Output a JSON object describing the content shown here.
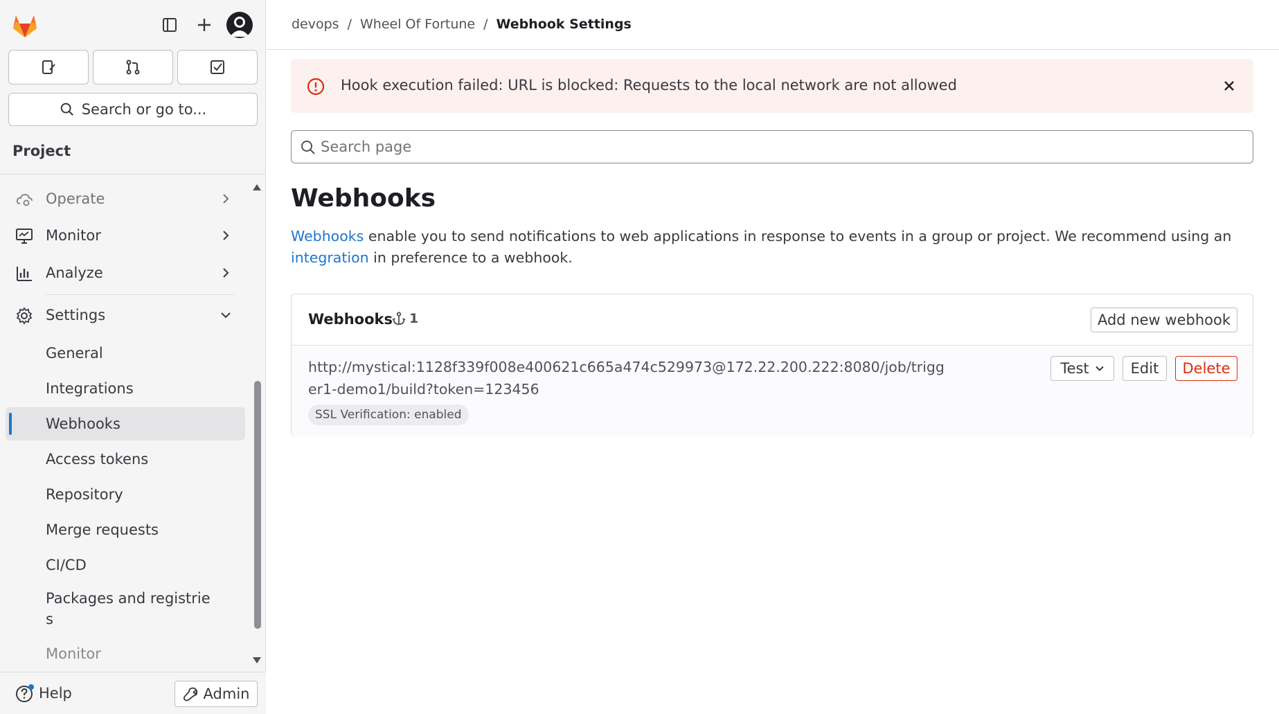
{
  "sidebar": {
    "section_title": "Project",
    "search_label": "Search or go to...",
    "nav": [
      {
        "label": "Operate",
        "icon": "cloud-gear-icon"
      },
      {
        "label": "Monitor",
        "icon": "monitor-icon"
      },
      {
        "label": "Analyze",
        "icon": "chart-icon"
      },
      {
        "label": "Settings",
        "icon": "gear-icon"
      }
    ],
    "settings_items": [
      "General",
      "Integrations",
      "Webhooks",
      "Access tokens",
      "Repository",
      "Merge requests",
      "CI/CD",
      "Packages and registrie s",
      "Monitor"
    ],
    "active_item": "Webhooks",
    "help_label": "Help",
    "admin_label": "Admin"
  },
  "breadcrumb": {
    "items": [
      "devops",
      "Wheel Of Fortune",
      "Webhook Settings"
    ]
  },
  "alert": {
    "message": "Hook execution failed: URL is blocked: Requests to the local network are not allowed"
  },
  "search": {
    "placeholder": "Search page"
  },
  "page": {
    "title": "Webhooks",
    "desc_link1": "Webhooks",
    "desc_text1": " enable you to send notifications to web applications in response to events in a group or project. We recommend using an ",
    "desc_link2": "integration",
    "desc_text2": " in preference to a webhook."
  },
  "card": {
    "title": "Webhooks",
    "count": "1",
    "add_label": "Add new webhook",
    "hook": {
      "url": "http://mystical:1128f339f008e400621c665a474c529973@172.22.200.222:8080/job/trigger1-demo1/build?token=123456",
      "ssl_badge": "SSL Verification: enabled",
      "test_label": "Test",
      "edit_label": "Edit",
      "delete_label": "Delete"
    }
  },
  "colors": {
    "link": "#1f75cb",
    "danger": "#dd2b0e",
    "alert_bg": "#fcf1ef",
    "brand_orange": "#e24329"
  }
}
